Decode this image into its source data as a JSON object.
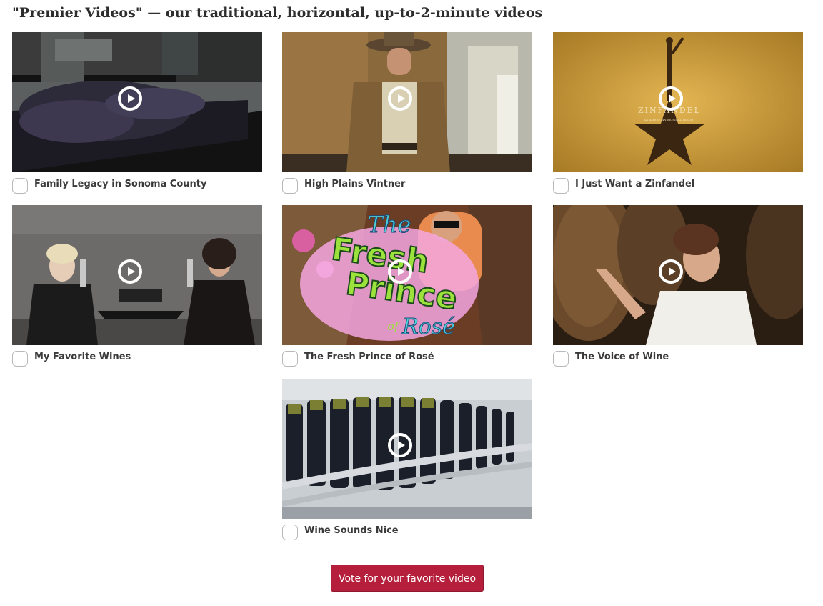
{
  "page": {
    "title": "\"Premier Videos\" — our traditional, horizontal, up-to-2-minute videos"
  },
  "videos": [
    {
      "label": "Family Legacy in Sonoma County",
      "checked": false
    },
    {
      "label": "High Plains Vintner",
      "checked": false
    },
    {
      "label": "I Just Want a Zinfandel",
      "checked": false,
      "thumbnail_text": {
        "title": "ZINFANDEL",
        "subtitle": "AN AMERICAN MUSICAL PARODY"
      }
    },
    {
      "label": "My Favorite Wines",
      "checked": false
    },
    {
      "label": "The Fresh Prince of Rosé",
      "checked": false,
      "thumbnail_text": {
        "the": "The",
        "fresh": "Fresh",
        "prince": "Prince",
        "of": "of",
        "rose": "Rosé"
      }
    },
    {
      "label": "The Voice of Wine",
      "checked": false
    },
    {
      "label": "Wine Sounds Nice",
      "checked": false
    }
  ],
  "icons": {
    "play": "play-circle-icon"
  },
  "vote": {
    "label": "Vote for your favorite video"
  },
  "colors": {
    "accent": "#b61f3c",
    "text": "#3a3a3a",
    "title": "#2d2d2d"
  }
}
